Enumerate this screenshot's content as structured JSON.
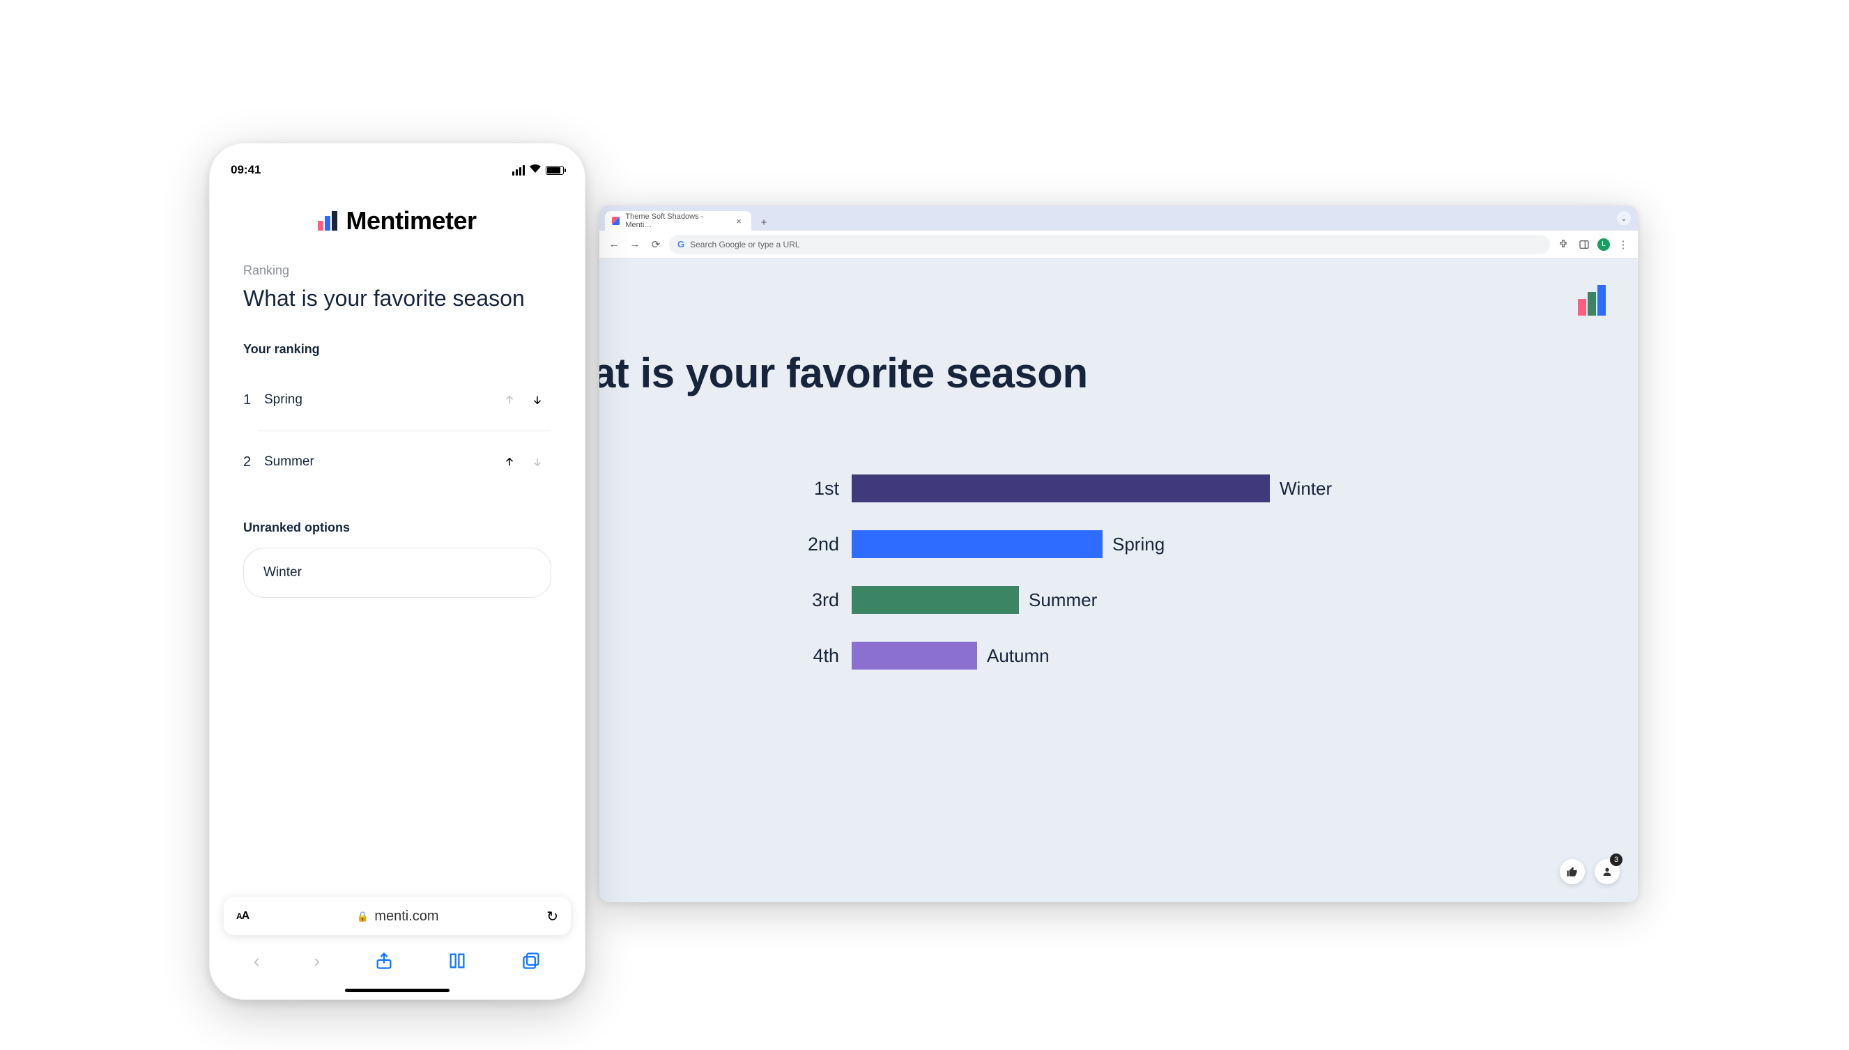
{
  "phone": {
    "time": "09:41",
    "brand": "Mentimeter",
    "kicker": "Ranking",
    "question": "What is your favorite season",
    "your_ranking_label": "Your ranking",
    "ranked": [
      {
        "n": "1",
        "name": "Spring",
        "up_enabled": false,
        "down_enabled": true
      },
      {
        "n": "2",
        "name": "Summer",
        "up_enabled": true,
        "down_enabled": false
      }
    ],
    "unranked_label": "Unranked options",
    "unranked": [
      {
        "name": "Winter"
      }
    ],
    "safari_url": "menti.com"
  },
  "desktop": {
    "tab_title": "Theme Soft Shadows - Menti…",
    "omnibox_placeholder": "Search Google or type a URL",
    "avatar_initial": "L",
    "presentation_title": "at is your favorite season",
    "participants_badge": "3"
  },
  "chart_data": {
    "type": "bar",
    "orientation": "horizontal",
    "title": "What is your favorite season",
    "xlabel": "",
    "ylabel": "",
    "categories": [
      "1st",
      "2nd",
      "3rd",
      "4th"
    ],
    "series": [
      {
        "name": "Winter",
        "rank": "1st",
        "value": 100,
        "color": "#403a7a"
      },
      {
        "name": "Spring",
        "rank": "2nd",
        "value": 60,
        "color": "#2e6cff"
      },
      {
        "name": "Summer",
        "rank": "3rd",
        "value": 40,
        "color": "#3b8564"
      },
      {
        "name": "Autumn",
        "rank": "4th",
        "value": 30,
        "color": "#8b6fd1"
      }
    ],
    "xlim": [
      0,
      100
    ]
  }
}
